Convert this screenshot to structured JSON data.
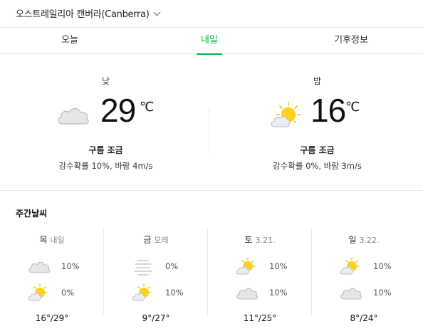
{
  "header": {
    "location": "오스트레일리아 캔버라(Canberra)"
  },
  "tabs": [
    {
      "label": "오늘",
      "active": false
    },
    {
      "label": "내일",
      "active": true
    },
    {
      "label": "기후정보",
      "active": false
    }
  ],
  "accent_color": "#00b843",
  "forecast": {
    "day": {
      "period": "낮",
      "icon": "cloud-icon",
      "temp": "29",
      "unit": "℃",
      "condition": "구름 조금",
      "detail": "강수확률 10%, 바람 4m/s"
    },
    "night": {
      "period": "밤",
      "icon": "sun-behind-cloud-icon",
      "temp": "16",
      "unit": "℃",
      "condition": "구름 조금",
      "detail": "강수확률 0%, 바람 3m/s"
    }
  },
  "weekly": {
    "title": "주간날씨",
    "days": [
      {
        "day": "목",
        "sub": "내일",
        "am_icon": "cloud-icon",
        "am_pct": "10%",
        "pm_icon": "sun-behind-cloud-icon",
        "pm_pct": "0%",
        "range": "16°/29°"
      },
      {
        "day": "금",
        "sub": "모레",
        "am_icon": "fog-icon",
        "am_pct": "0%",
        "pm_icon": "sun-behind-cloud-icon",
        "pm_pct": "10%",
        "range": "9°/27°"
      },
      {
        "day": "토",
        "sub": "3.21.",
        "am_icon": "sun-behind-cloud-icon",
        "am_pct": "10%",
        "pm_icon": "cloud-icon",
        "pm_pct": "10%",
        "range": "11°/25°"
      },
      {
        "day": "일",
        "sub": "3.22.",
        "am_icon": "sun-behind-cloud-icon",
        "am_pct": "10%",
        "pm_icon": "cloud-icon",
        "pm_pct": "10%",
        "range": "8°/24°"
      }
    ]
  }
}
